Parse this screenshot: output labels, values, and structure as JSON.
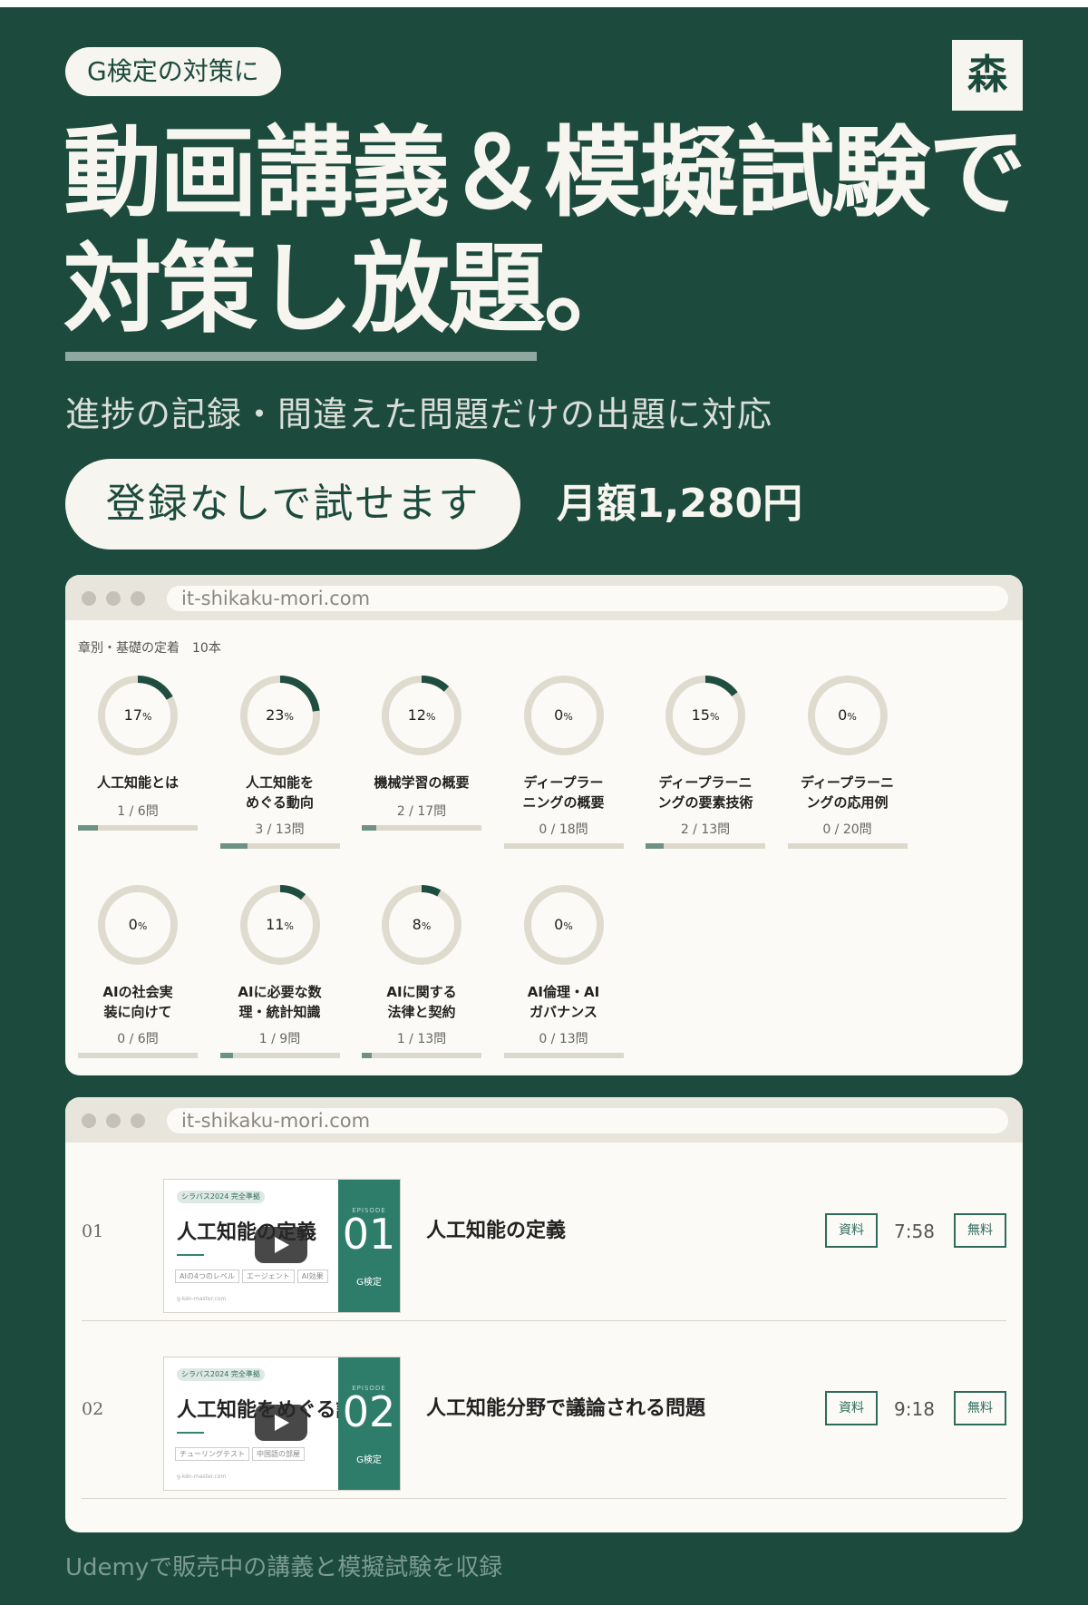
{
  "hero": {
    "pill": "G検定の対策に",
    "logo": "森",
    "headline_line1": "動画講義＆模擬試験で",
    "headline_line2": "対策し放題。",
    "subhead": "進捗の記録・間違えた問題だけの出題に対応",
    "cta": "登録なしで試せます",
    "price": "月額1,280円"
  },
  "browser": {
    "url": "it-shikaku-mori.com"
  },
  "progress": {
    "label": "章別・基礎の定着　10本",
    "pct_unit": "%",
    "chapters": [
      {
        "pct": "17",
        "title_lines": [
          "人工知能とは"
        ],
        "count": "1 / 6問",
        "fill": 0.17
      },
      {
        "pct": "23",
        "title_lines": [
          "人工知能を",
          "めぐる動向"
        ],
        "count": "3 / 13問",
        "fill": 0.23
      },
      {
        "pct": "12",
        "title_lines": [
          "機械学習の概要"
        ],
        "count": "2 / 17問",
        "fill": 0.12
      },
      {
        "pct": "0",
        "title_lines": [
          "ディープラー",
          "ニングの概要"
        ],
        "count": "0 / 18問",
        "fill": 0
      },
      {
        "pct": "15",
        "title_lines": [
          "ディープラーニ",
          "ングの要素技術"
        ],
        "count": "2 / 13問",
        "fill": 0.15
      },
      {
        "pct": "0",
        "title_lines": [
          "ディープラーニ",
          "ングの応用例"
        ],
        "count": "0 / 20問",
        "fill": 0
      },
      {
        "pct": "0",
        "title_lines": [
          "AIの社会実",
          "装に向けて"
        ],
        "count": "0 / 6問",
        "fill": 0
      },
      {
        "pct": "11",
        "title_lines": [
          "AIに必要な数",
          "理・統計知識"
        ],
        "count": "1 / 9問",
        "fill": 0.11
      },
      {
        "pct": "8",
        "title_lines": [
          "AIに関する",
          "法律と契約"
        ],
        "count": "1 / 13問",
        "fill": 0.08
      },
      {
        "pct": "0",
        "title_lines": [
          "AI倫理・AI",
          "ガバナンス"
        ],
        "count": "0 / 13問",
        "fill": 0
      }
    ]
  },
  "lectures": [
    {
      "num": "01",
      "thumb_tag": "シラバス2024 完全準拠",
      "thumb_title": "人工知能の定義",
      "thumb_chips": [
        "AIの4つのレベル",
        "エージェント",
        "AI効果"
      ],
      "thumb_url": "g-kén-master.com",
      "thumb_ep": "EPISODE",
      "thumb_num": "01",
      "thumb_g": "G検定",
      "title": "人工知能の定義",
      "doc": "資料",
      "duration": "7:58",
      "free": "無料"
    },
    {
      "num": "02",
      "thumb_tag": "シラバス2024 完全準拠",
      "thumb_title": "人工知能をめぐる議論",
      "thumb_chips": [
        "チューリングテスト",
        "中国語の部屋"
      ],
      "thumb_url": "g-kén-master.com",
      "thumb_ep": "EPISODE",
      "thumb_num": "02",
      "thumb_g": "G検定",
      "title": "人工知能分野で議論される問題",
      "doc": "資料",
      "duration": "9:18",
      "free": "無料"
    }
  ],
  "footer": "Udemyで販売中の講義と模擬試験を収録",
  "colors": {
    "bg": "#1c4b3e",
    "cream": "#f7f5ef",
    "ring_track": "#e0dbcf",
    "ring_fill": "#1f4d40",
    "accent": "#2e7d6a"
  }
}
